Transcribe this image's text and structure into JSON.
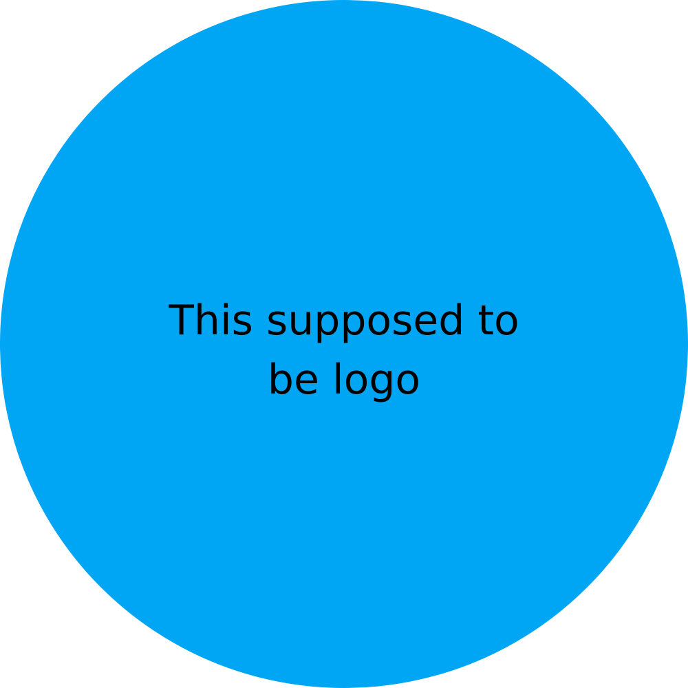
{
  "logo": {
    "lines": [
      "This supposed to",
      "be logo"
    ],
    "fill_color": "#00A6F4",
    "text_color": "#000000"
  }
}
